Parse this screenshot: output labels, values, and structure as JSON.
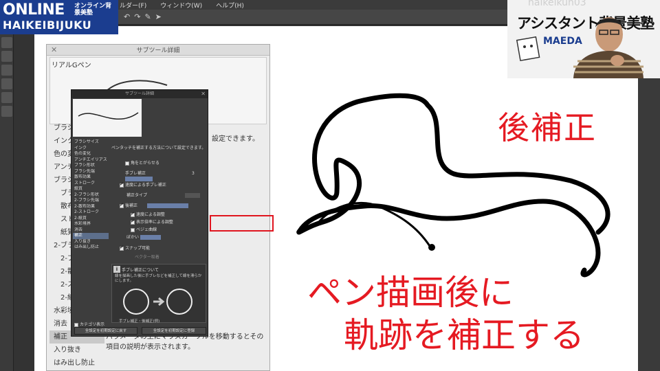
{
  "brand": {
    "line1": "ONLINE",
    "line1_jp": "オンライン背景美塾",
    "line2": "HAIKEIBIJUKU"
  },
  "menubar": {
    "items": [
      "ルダー(F)",
      "ウィンドウ(W)",
      "ヘルプ(H)"
    ]
  },
  "webcam": {
    "faint_text": "haikeikun03",
    "assistant_text": "アシスタント背景美塾",
    "maeda": "MAEDA"
  },
  "subtool_detail": {
    "title": "サブツール詳細",
    "tool_name": "リアルGペン",
    "categories": [
      "ブラシ",
      "インク",
      "色の変化",
      "アンチ",
      "ブラシ",
      "ブラ",
      "散布効",
      "ストロ",
      "紙質",
      "2-ブラ",
      "2-ブ",
      "2-散",
      "2-ス",
      "2-紙",
      "水彩境",
      "消去",
      "補正",
      "入り抜き",
      "はみ出し防止"
    ],
    "active_category": "補正",
    "settings_text": "設定できます。",
    "description": "パラメータの上にマウスカーソルを移動するとその項目の説明が表示されます。"
  },
  "popup": {
    "title": "サブツール詳細",
    "list": [
      "ブラシサイズ",
      "インク",
      "色の変化",
      "アンチエイリアス",
      "ブラシ形状",
      "ブラシ先端",
      "散布効果",
      "ストローク",
      "紙質",
      "2-ブラシ形状",
      "2-ブラシ先端",
      "2-散布効果",
      "2-ストローク",
      "2-紙質",
      "水彩境界",
      "消去",
      "補正",
      "入り抜き",
      "はみ出し防止"
    ],
    "active": "補正",
    "intro": "ペンタッチを補正する方法について設定できます。",
    "rows": {
      "corner": "角をとがらせる",
      "stabilize": "手ブレ補正",
      "stabilize_value": "3",
      "speed": "速度による手ブレ補正",
      "type": "補正タイプ",
      "post": "後補正",
      "post_speed": "速度による調整",
      "post_zoom": "表示倍率による調整",
      "bezier": "ベジェ曲線",
      "smooth": "ぼかい",
      "snap": "スナップ可能",
      "vector": "ベクター吸着"
    },
    "info_title": "手ブレ補正について",
    "info_body": "線を描画した後に手ブレなどを補正して線を滑らかにします。",
    "info_label": "手ブレ補正・後補正(例)",
    "category_display": "カテゴリ表示",
    "btn_reset": "全設定を初期設定に戻す",
    "btn_register": "全設定を初期設定に登録"
  },
  "annotations": {
    "title": "後補正",
    "line1": "ペン描画後に",
    "line2": "軌跡を補正する"
  },
  "colors": {
    "annotation_red": "#e51a22",
    "brand_blue": "#1b3d8f",
    "panel_dark": "#3d3d3d"
  }
}
